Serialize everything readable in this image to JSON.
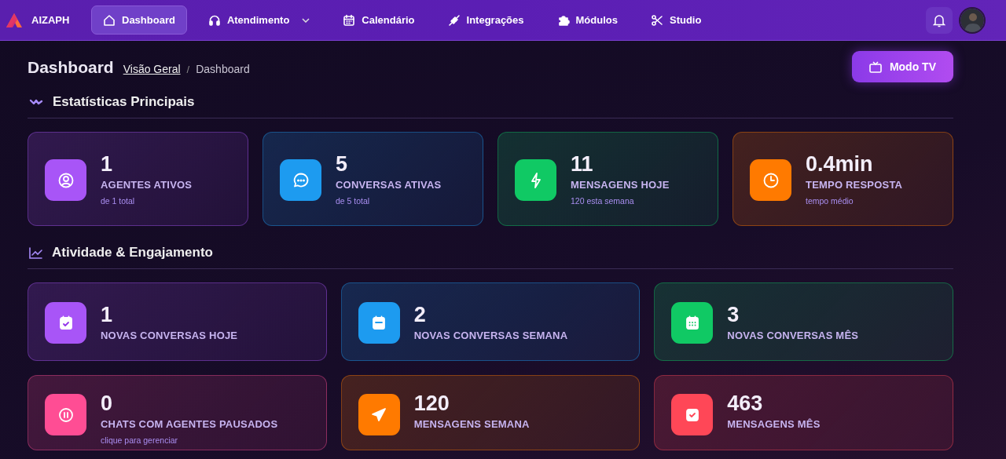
{
  "brand": {
    "name": "AIZAPH"
  },
  "nav": [
    {
      "label": "Dashboard",
      "kind": "link",
      "selected": true
    },
    {
      "label": "Atendimento",
      "kind": "dropdown",
      "selected": false
    },
    {
      "label": "Calendário",
      "kind": "link",
      "selected": false
    },
    {
      "label": "Integrações",
      "kind": "link",
      "selected": false
    },
    {
      "label": "Módulos",
      "kind": "link",
      "selected": false
    },
    {
      "label": "Studio",
      "kind": "link",
      "selected": false
    }
  ],
  "page": {
    "title": "Dashboard",
    "breadcrumb": [
      "Visão Geral",
      "/",
      "Dashboard"
    ],
    "action": "Modo TV"
  },
  "sections": [
    {
      "title": "Estatísticas Principais",
      "cards": [
        {
          "value": "1",
          "label": "AGENTES ATIVOS",
          "note": "de 1 total",
          "color": "#a855f7"
        },
        {
          "value": "5",
          "label": "CONVERSAS ATIVAS",
          "note": "de 5 total",
          "color": "#1d9bf0"
        },
        {
          "value": "11",
          "label": "MENSAGENS HOJE",
          "note": "120 esta semana",
          "color": "#10c964"
        },
        {
          "value": "0.4min",
          "label": "TEMPO RESPOSTA",
          "note": "tempo médio",
          "color": "#ff7a00"
        }
      ]
    },
    {
      "title": "Atividade & Engajamento",
      "cards": [
        {
          "value": "1",
          "label": "NOVAS CONVERSAS HOJE",
          "color": "#a855f7"
        },
        {
          "value": "2",
          "label": "NOVAS CONVERSAS SEMANA",
          "color": "#1d9bf0"
        },
        {
          "value": "3",
          "label": "NOVAS CONVERSAS MÊS",
          "color": "#10c964"
        },
        {
          "value": "0",
          "label": "CHATS COM AGENTES PAUSADOS",
          "note": "clique para gerenciar",
          "color": "#ff4d94"
        },
        {
          "value": "120",
          "label": "MENSAGENS SEMANA",
          "color": "#ff7a00"
        },
        {
          "value": "463",
          "label": "MENSAGENS MÊS",
          "color": "#ff4757"
        }
      ]
    }
  ]
}
